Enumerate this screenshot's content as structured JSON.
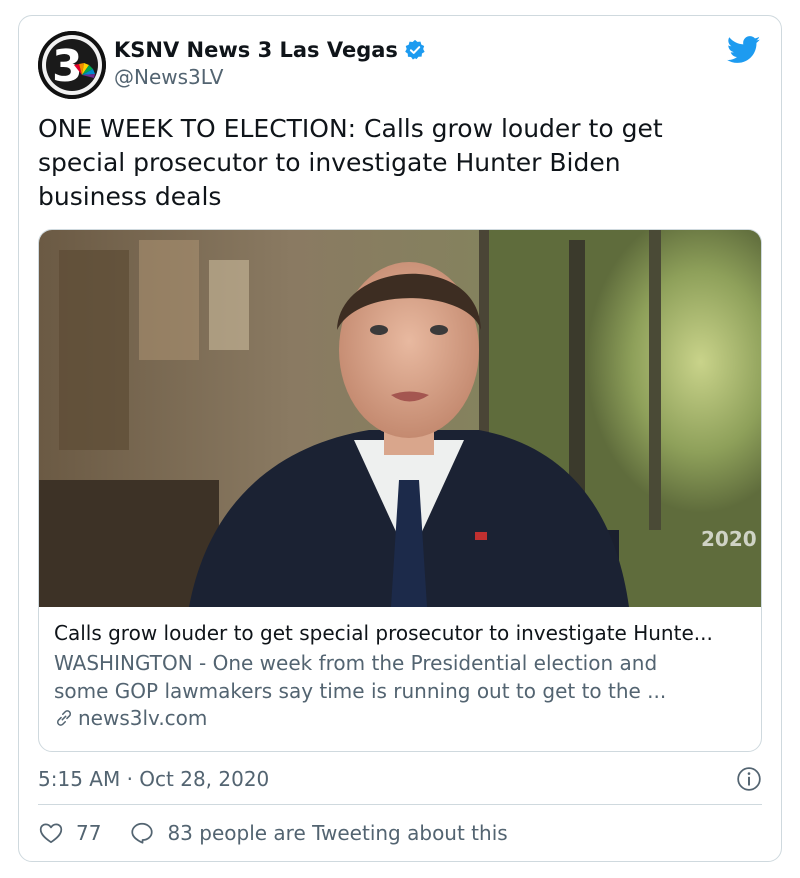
{
  "author": {
    "display_name": "KSNV News 3 Las Vegas",
    "handle": "@News3LV",
    "avatar_icon": "news3-logo",
    "verified": true
  },
  "tweet": {
    "lines": [
      "ONE WEEK TO ELECTION: Calls grow louder to get",
      "special prosecutor to investigate Hunter Biden",
      "business deals"
    ]
  },
  "link_card": {
    "image_desc": "news-video-still",
    "image_watermark": "2020",
    "title": "Calls grow louder to get special prosecutor to investigate Hunte...",
    "description_lines": [
      "WASHINGTON - One week from the Presidential election and",
      "some GOP lawmakers say time is running out to get to the ..."
    ],
    "domain": "news3lv.com"
  },
  "meta": {
    "timestamp": "5:15 AM · Oct 28, 2020"
  },
  "actions": {
    "likes": "77",
    "conversation": "83 people are Tweeting about this"
  },
  "colors": {
    "twitter_blue": "#1d9bf0",
    "text_primary": "#0f1419",
    "text_secondary": "#536471",
    "border": "#cfd9de"
  }
}
